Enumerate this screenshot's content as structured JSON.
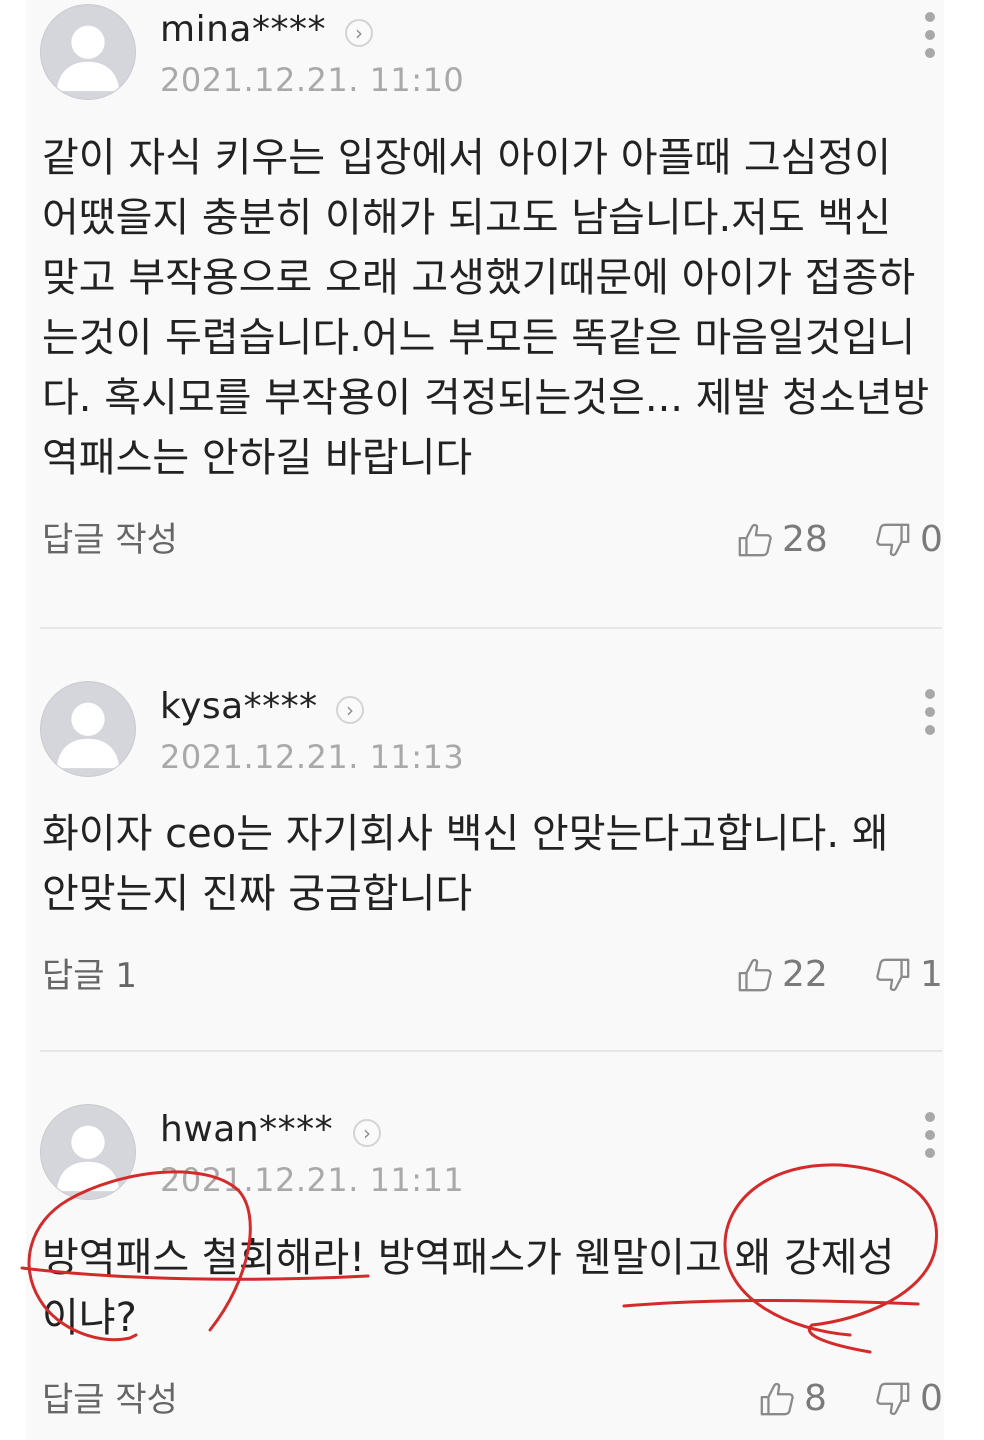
{
  "comments": [
    {
      "username": "mina****",
      "timestamp": "2021.12.21. 11:10",
      "text": "같이 자식 키우는 입장에서 아이가 아플때 그심정이\n어땠을지 충분히 이해가 되고도 남습니다.저도 백신\n맞고 부작용으로 오래 고생했기때문에 아이가 접종하\n는것이 두렵습니다.어느 부모든 똑같은 마음일것입니\n다. 혹시모를 부작용이 걱정되는것은... 제발 청소년방\n역패스는 안하길 바랍니다",
      "reply_label": "답글 작성",
      "likes": "28",
      "dislikes": "0"
    },
    {
      "username": "kysa****",
      "timestamp": "2021.12.21. 11:13",
      "text": "화이자 ceo는 자기회사 백신 안맞는다고합니다. 왜\n안맞는지 진짜 궁금합니다",
      "reply_label": "답글 1",
      "likes": "22",
      "dislikes": "1"
    },
    {
      "username": "hwan****",
      "timestamp": "2021.12.21. 11:11",
      "text": "방역패스 철회해라! 방역패스가 웬말이고 왜 강제성\n이냐?",
      "reply_label": "답글 작성",
      "likes": "8",
      "dislikes": "0"
    }
  ],
  "icons": {
    "profile_arrow": "chevron-right-icon",
    "more": "kebab-menu-icon",
    "like": "thumbs-up-icon",
    "dislike": "thumbs-down-icon"
  },
  "colors": {
    "annotation": "#d42a2a",
    "timestamp": "#a9a9a9",
    "background": "#f9f9f9"
  }
}
